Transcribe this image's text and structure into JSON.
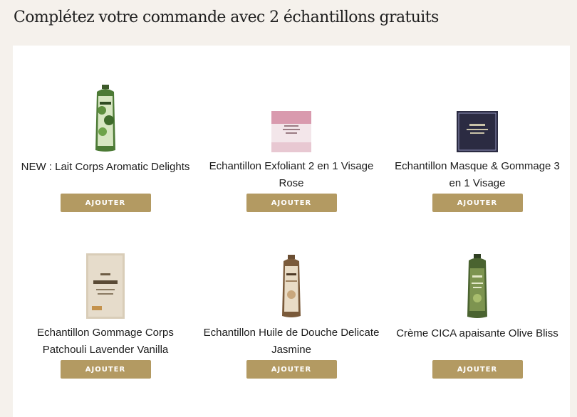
{
  "title": "Complétez votre commande avec 2 échantillons gratuits",
  "products": [
    {
      "name": "NEW : Lait Corps Aromatic Delights",
      "button": "AJOUTER",
      "image": "green-bottle-aromatic-delights"
    },
    {
      "name": "Echantillon Exfoliant 2 en 1 Visage Rose",
      "button": "AJOUTER",
      "image": "pink-sachet-rose"
    },
    {
      "name": "Echantillon Masque & Gommage 3 en 1 Visage",
      "button": "AJOUTER",
      "image": "dark-sachet-dead-sea"
    },
    {
      "name": "Echantillon Gommage Corps Patchouli Lavender Vanilla",
      "button": "AJOUTER",
      "image": "beige-sachet-body-scrub"
    },
    {
      "name": "Echantillon Huile de Douche Delicate Jasmine",
      "button": "AJOUTER",
      "image": "brown-bottle-shower-oil"
    },
    {
      "name": "Crème CICA apaisante Olive Bliss",
      "button": "AJOUTER",
      "image": "olive-bottle-cica"
    }
  ],
  "colors": {
    "button": "#b39a62",
    "background": "#f5f1ec",
    "panel": "#ffffff"
  }
}
